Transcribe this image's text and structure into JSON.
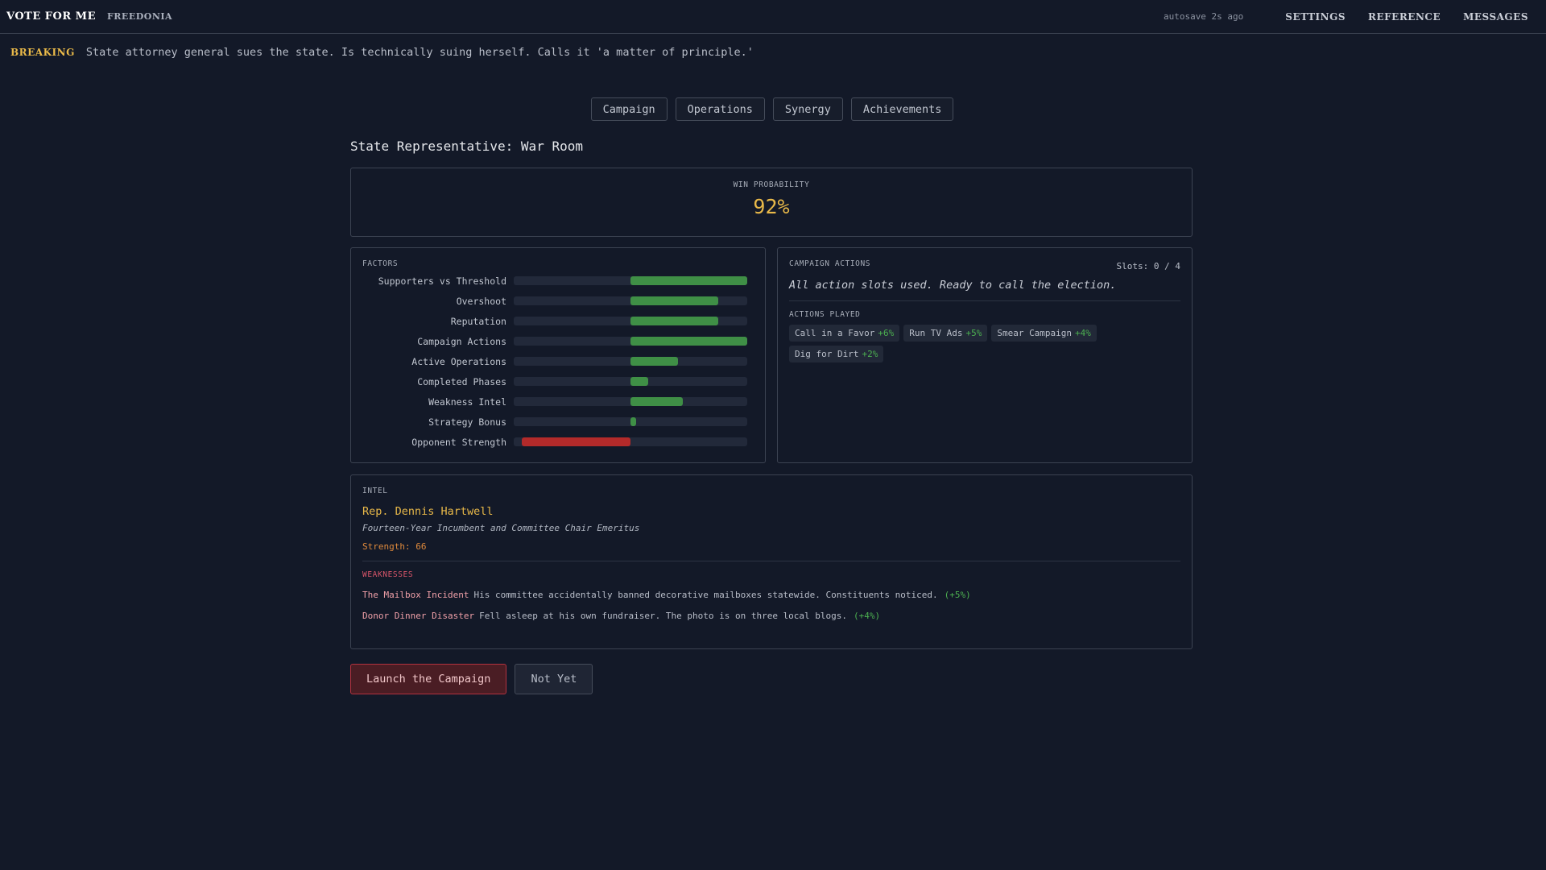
{
  "header": {
    "brand": "VOTE FOR ME",
    "region": "FREEDONIA",
    "autosave": "autosave 2s ago",
    "nav": [
      "SETTINGS",
      "REFERENCE",
      "MESSAGES"
    ]
  },
  "breaking": {
    "tag": "BREAKING",
    "text": "State attorney general sues the state. Is technically suing herself. Calls it 'a matter of principle.'"
  },
  "tabs": [
    "Campaign",
    "Operations",
    "Synergy",
    "Achievements"
  ],
  "page_title": "State Representative: War Room",
  "win": {
    "label": "WIN PROBABILITY",
    "value": "92%"
  },
  "factors": {
    "label": "FACTORS",
    "items": [
      {
        "name": "Supporters vs Threshold",
        "value": 1.0,
        "color": "#3f8f46"
      },
      {
        "name": "Overshoot",
        "value": 0.75,
        "color": "#3f8f46"
      },
      {
        "name": "Reputation",
        "value": 0.75,
        "color": "#3f8f46"
      },
      {
        "name": "Campaign Actions",
        "value": 1.0,
        "color": "#3f8f46"
      },
      {
        "name": "Active Operations",
        "value": 0.41,
        "color": "#3f8f46"
      },
      {
        "name": "Completed Phases",
        "value": 0.15,
        "color": "#3f8f46"
      },
      {
        "name": "Weakness Intel",
        "value": 0.45,
        "color": "#3f8f46"
      },
      {
        "name": "Strategy Bonus",
        "value": 0.05,
        "color": "#3f8f46"
      },
      {
        "name": "Opponent Strength",
        "value": -0.93,
        "color": "#b32a2a"
      }
    ]
  },
  "campaign_actions": {
    "label": "CAMPAIGN ACTIONS",
    "slots": "Slots: 0 / 4",
    "message": "All action slots used. Ready to call the election.",
    "played_label": "ACTIONS PLAYED",
    "played": [
      {
        "name": "Call in a Favor",
        "bonus": "+6%"
      },
      {
        "name": "Run TV Ads",
        "bonus": "+5%"
      },
      {
        "name": "Smear Campaign",
        "bonus": "+4%"
      },
      {
        "name": "Dig for Dirt",
        "bonus": "+2%"
      }
    ]
  },
  "intel": {
    "label": "INTEL",
    "opponent_name": "Rep. Dennis Hartwell",
    "opponent_title": "Fourteen-Year Incumbent and Committee Chair Emeritus",
    "strength": "Strength: 66",
    "weaknesses_label": "WEAKNESSES",
    "weaknesses": [
      {
        "name": "The Mailbox Incident",
        "desc": "His committee accidentally banned decorative mailboxes statewide. Constituents noticed.",
        "bonus": "(+5%)"
      },
      {
        "name": "Donor Dinner Disaster",
        "desc": "Fell asleep at his own fundraiser. The photo is on three local blogs.",
        "bonus": "(+4%)"
      }
    ]
  },
  "buttons": {
    "launch": "Launch the Campaign",
    "not_yet": "Not Yet"
  }
}
